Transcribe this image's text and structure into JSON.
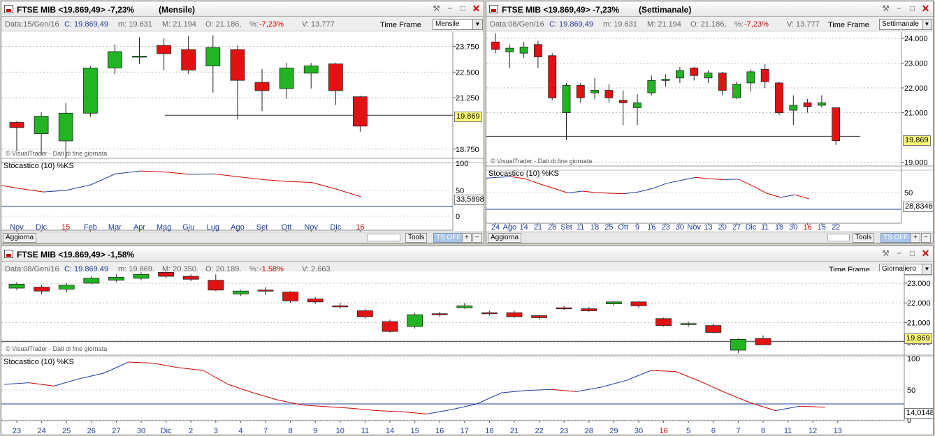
{
  "colors": {
    "up": "#22b422",
    "down": "#e31212",
    "k": "#1d3c9c",
    "d": "#d20000",
    "hline": "#1d3c9c"
  },
  "panels": [
    {
      "id": "p1",
      "title": "FTSE MIB <19.869,49> -7,23%",
      "period": "(Mensile)",
      "info": {
        "data": "Data:15/Gen/16",
        "c": "C: 19.869,49",
        "m": "m: 19.631",
        "M": "M: 21.194",
        "o": "O: 21.186,",
        "pct_label": "%:",
        "pct": "-7,23%",
        "v": "V: 13.777"
      },
      "timeframe_label": "Time Frame",
      "timeframe_value": "Mensile",
      "watermark": "© VisualTrader - Dati di fine giornata",
      "stoch_label": "Stocastico (10) %KS",
      "price_badge": "19.869",
      "stoch_badge": "33,5898",
      "y_labels": [
        "23.750",
        "22.500",
        "21.250",
        "18.750"
      ],
      "stoch_y_labels": [
        "100",
        "50",
        "0"
      ],
      "x_labels": [
        {
          "t": "Nov"
        },
        {
          "t": "Dic"
        },
        {
          "t": "15",
          "red": true
        },
        {
          "t": "Feb"
        },
        {
          "t": "Mar"
        },
        {
          "t": "Apr"
        },
        {
          "t": "Mag"
        },
        {
          "t": "Giu"
        },
        {
          "t": "Lug"
        },
        {
          "t": "Ago"
        },
        {
          "t": "Set"
        },
        {
          "t": "Ott"
        },
        {
          "t": "Nov"
        },
        {
          "t": "Dic"
        },
        {
          "t": "16",
          "red": true
        }
      ],
      "candles": [
        [
          20.05,
          19.8,
          20.12,
          18.65
        ],
        [
          19.5,
          20.35,
          20.55,
          18.45
        ],
        [
          19.15,
          20.5,
          21.0,
          18.3
        ],
        [
          20.5,
          22.7,
          22.8,
          20.3
        ],
        [
          22.7,
          23.5,
          23.85,
          22.4
        ],
        [
          23.25,
          23.28,
          24.2,
          22.9
        ],
        [
          23.8,
          23.4,
          24.15,
          22.6
        ],
        [
          23.6,
          22.6,
          24.25,
          22.4
        ],
        [
          22.8,
          23.7,
          24.3,
          21.5
        ],
        [
          23.6,
          22.1,
          23.8,
          20.2
        ],
        [
          22.0,
          21.6,
          22.65,
          20.6
        ],
        [
          21.7,
          22.7,
          22.95,
          21.2
        ],
        [
          22.45,
          22.8,
          22.95,
          21.7
        ],
        [
          22.9,
          21.6,
          22.95,
          20.9
        ],
        [
          21.3,
          19.87,
          21.35,
          19.6
        ]
      ],
      "support": 20.4,
      "stoch": [
        58,
        52,
        44,
        47,
        59,
        82,
        88,
        86,
        81,
        82,
        76,
        70,
        66,
        64,
        50,
        33.59
      ],
      "hline": 14,
      "bottom": {
        "refresh": "Aggiorna",
        "tools": "Tools",
        "ts": "TS OFF",
        "plus": "+",
        "minus": "−"
      }
    },
    {
      "id": "p2",
      "title": "FTSE MIB <19.869,49> -7,23%",
      "period": "(Settimanale)",
      "info": {
        "data": "Data:08/Gen/16",
        "c": "C: 19.869,49",
        "m": "m: 19.631",
        "M": "M: 21.194",
        "o": "O: 21.186,",
        "pct_label": "%:",
        "pct": "-7,23%",
        "v": "V: 13.777"
      },
      "timeframe_label": "Time Frame",
      "timeframe_value": "Settimanale",
      "watermark": "© VisualTrader - Dati di fine giornata",
      "stoch_label": "Stocastico (10) %KS",
      "price_badge": "19.869",
      "stoch_badge": "28,8346",
      "y_labels": [
        "24.000",
        "23.000",
        "22.000",
        "21.000",
        "19.000"
      ],
      "stoch_y_labels": [
        "50"
      ],
      "x_labels": [
        {
          "t": "24"
        },
        {
          "t": "Ago"
        },
        {
          "t": "14"
        },
        {
          "t": "21"
        },
        {
          "t": "28"
        },
        {
          "t": "Set"
        },
        {
          "t": "11"
        },
        {
          "t": "18"
        },
        {
          "t": "25"
        },
        {
          "t": "Ott"
        },
        {
          "t": "9"
        },
        {
          "t": "16"
        },
        {
          "t": "23"
        },
        {
          "t": "30"
        },
        {
          "t": "Nov"
        },
        {
          "t": "13"
        },
        {
          "t": "20"
        },
        {
          "t": "27"
        },
        {
          "t": "Dic"
        },
        {
          "t": "11"
        },
        {
          "t": "18"
        },
        {
          "t": "30"
        },
        {
          "t": "16",
          "red": true
        },
        {
          "t": "15"
        },
        {
          "t": "22"
        }
      ],
      "candles": [
        [
          23.85,
          23.55,
          24.2,
          23.4
        ],
        [
          23.45,
          23.6,
          23.75,
          22.8
        ],
        [
          23.4,
          23.65,
          23.85,
          23.2
        ],
        [
          23.75,
          23.25,
          23.9,
          22.8
        ],
        [
          23.3,
          21.6,
          23.4,
          21.5
        ],
        [
          21.0,
          22.1,
          22.2,
          19.9
        ],
        [
          22.1,
          21.6,
          22.2,
          21.4
        ],
        [
          21.8,
          21.9,
          22.4,
          21.55
        ],
        [
          21.9,
          21.6,
          22.15,
          21.4
        ],
        [
          21.5,
          21.4,
          21.9,
          20.5
        ],
        [
          21.2,
          21.4,
          21.75,
          20.5
        ],
        [
          21.8,
          22.3,
          22.5,
          21.7
        ],
        [
          22.3,
          22.35,
          22.55,
          22.05
        ],
        [
          22.4,
          22.7,
          22.85,
          22.2
        ],
        [
          22.8,
          22.5,
          22.85,
          22.3
        ],
        [
          22.4,
          22.6,
          22.7,
          22.2
        ],
        [
          22.6,
          21.9,
          22.65,
          21.7
        ],
        [
          21.6,
          22.15,
          22.25,
          21.55
        ],
        [
          22.2,
          22.65,
          22.75,
          21.85
        ],
        [
          22.75,
          22.25,
          22.95,
          22.0
        ],
        [
          22.2,
          21.0,
          22.25,
          20.9
        ],
        [
          21.1,
          21.3,
          21.7,
          20.5
        ],
        [
          21.4,
          21.25,
          21.55,
          21.0
        ],
        [
          21.3,
          21.4,
          21.7,
          21.2
        ],
        [
          21.2,
          19.87,
          21.22,
          19.7
        ]
      ],
      "support": 20.05,
      "stoch": [
        85,
        88,
        90,
        84,
        70,
        58,
        45,
        50,
        46,
        44,
        43,
        48,
        58,
        72,
        80,
        88,
        84,
        82,
        83,
        65,
        44,
        33,
        40,
        28.83
      ],
      "hline": 0,
      "bottom": {
        "refresh": "Aggiorna",
        "tools": "Tools",
        "ts": "TS OFF",
        "plus": "+",
        "minus": "−"
      }
    },
    {
      "id": "p3",
      "title": "FTSE MIB <19.869,49> -1,58%",
      "period": "",
      "info": {
        "data": "Data:08/Gen/16",
        "c": "C: 19.869,49",
        "m": "m: 19.869,",
        "M": "M: 20.350,",
        "o": "O: 20.189,",
        "pct_label": "%:",
        "pct": "-1,58%",
        "v": "V: 2.663"
      },
      "timeframe_label": "Time Frame",
      "timeframe_value": "Giornaliero",
      "watermark": "© VisualTrader - Dati di fine giornata",
      "stoch_label": "Stocastico (10) %KS",
      "price_badge": "19.869",
      "stoch_badge": "14,0148",
      "y_labels": [
        "23.000",
        "22.000",
        "21.000",
        "20.000"
      ],
      "stoch_y_labels": [
        "100",
        "50",
        "0"
      ],
      "x_labels": [
        {
          "t": "23"
        },
        {
          "t": "24"
        },
        {
          "t": "25"
        },
        {
          "t": "26"
        },
        {
          "t": "27"
        },
        {
          "t": "30"
        },
        {
          "t": "Dic"
        },
        {
          "t": "2"
        },
        {
          "t": "3"
        },
        {
          "t": "4"
        },
        {
          "t": "7"
        },
        {
          "t": "8"
        },
        {
          "t": "9"
        },
        {
          "t": "10"
        },
        {
          "t": "11"
        },
        {
          "t": "14"
        },
        {
          "t": "15"
        },
        {
          "t": "16"
        },
        {
          "t": "17"
        },
        {
          "t": "18"
        },
        {
          "t": "21"
        },
        {
          "t": "22"
        },
        {
          "t": "23"
        },
        {
          "t": "28"
        },
        {
          "t": "29"
        },
        {
          "t": "30"
        },
        {
          "t": "16",
          "red": true
        },
        {
          "t": "5"
        },
        {
          "t": "6"
        },
        {
          "t": "7"
        },
        {
          "t": "8"
        },
        {
          "t": "11"
        },
        {
          "t": "12"
        },
        {
          "t": "13"
        }
      ],
      "candles": [
        [
          22.75,
          22.95,
          23.05,
          22.65
        ],
        [
          22.8,
          22.6,
          22.9,
          22.45
        ],
        [
          22.7,
          22.9,
          23.0,
          22.55
        ],
        [
          23.0,
          23.25,
          23.35,
          22.95
        ],
        [
          23.15,
          23.3,
          23.45,
          23.05
        ],
        [
          23.25,
          23.45,
          23.55,
          23.15
        ],
        [
          23.55,
          23.35,
          23.6,
          23.25
        ],
        [
          23.35,
          23.2,
          23.45,
          23.1
        ],
        [
          23.15,
          22.65,
          23.45,
          22.6
        ],
        [
          22.45,
          22.6,
          22.65,
          22.35
        ],
        [
          22.65,
          22.6,
          22.8,
          22.4
        ],
        [
          22.55,
          22.1,
          22.6,
          22.0
        ],
        [
          22.2,
          22.05,
          22.3,
          21.95
        ],
        [
          21.85,
          21.8,
          22.0,
          21.7
        ],
        [
          21.6,
          21.3,
          21.7,
          21.2
        ],
        [
          21.05,
          20.55,
          21.15,
          20.5
        ],
        [
          20.8,
          21.4,
          21.5,
          20.7
        ],
        [
          21.45,
          21.4,
          21.55,
          21.3
        ],
        [
          21.75,
          21.85,
          22.0,
          21.7
        ],
        [
          21.5,
          21.45,
          21.6,
          21.35
        ],
        [
          21.5,
          21.3,
          21.6,
          21.25
        ],
        [
          21.35,
          21.25,
          21.4,
          21.15
        ],
        [
          21.75,
          21.7,
          21.85,
          21.65
        ],
        [
          21.7,
          21.6,
          21.8,
          21.55
        ],
        [
          21.95,
          22.05,
          22.1,
          21.85
        ],
        [
          22.05,
          21.85,
          22.1,
          21.75
        ],
        [
          21.2,
          20.85,
          21.25,
          20.8
        ],
        [
          20.95,
          20.95,
          21.05,
          20.8
        ],
        [
          20.85,
          20.5,
          20.95,
          20.45
        ],
        [
          19.6,
          20.15,
          20.2,
          19.45
        ],
        [
          20.19,
          19.87,
          20.35,
          19.87
        ]
      ],
      "support": 20.05,
      "stoch": [
        55,
        58,
        52,
        65,
        75,
        95,
        93,
        85,
        80,
        55,
        40,
        27,
        18,
        15,
        12,
        8,
        6,
        2,
        10,
        20,
        40,
        44,
        46,
        42,
        50,
        62,
        80,
        78,
        60,
        40,
        22,
        8,
        16,
        14.01
      ],
      "hline": 20,
      "bottom": null
    }
  ]
}
